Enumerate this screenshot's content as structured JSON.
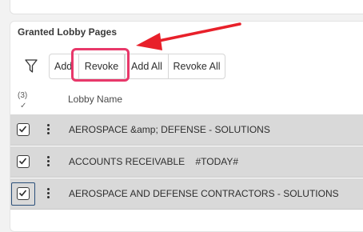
{
  "section": {
    "title": "Granted Lobby Pages"
  },
  "toolbar": {
    "add_label": "Add",
    "revoke_label": "Revoke",
    "add_all_label": "Add All",
    "revoke_all_label": "Revoke All"
  },
  "table": {
    "count": "(3)",
    "sort_indicator": "✓",
    "column_header": "Lobby Name",
    "rows": [
      {
        "name": "AEROSPACE &amp; DEFENSE - SOLUTIONS",
        "checked": true
      },
      {
        "name": "ACCOUNTS RECEIVABLE    #TODAY#",
        "checked": true
      },
      {
        "name": "AEROSPACE AND DEFENSE CONTRACTORS - SOLUTIONS",
        "checked": true
      }
    ]
  },
  "icons": {
    "filter": "filter-icon",
    "row_menu": "kebab-menu-icon",
    "check": "checkmark-icon"
  },
  "colors": {
    "highlight": "#e8386a",
    "arrow": "#e8202a",
    "row_selected_bg": "#d9d9d9",
    "focus_ring": "#2b4f7a"
  }
}
